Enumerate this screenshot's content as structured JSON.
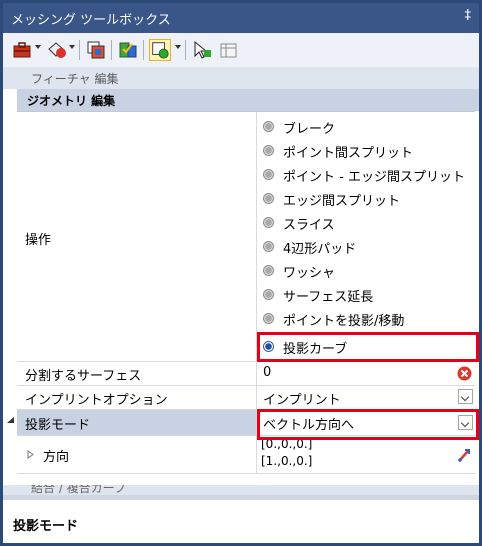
{
  "window": {
    "title": "メッシング ツールボックス",
    "pin_glyph": "‡"
  },
  "subtab": {
    "label": "フィーチャ 編集"
  },
  "category": {
    "label": "ジオメトリ 編集"
  },
  "properties": {
    "operation": {
      "label": "操作",
      "options": [
        "ブレーク",
        "ポイント間スプリット",
        "ポイント - エッジ間スプリット",
        "エッジ間スプリット",
        "スライス",
        "4辺形パッド",
        "ワッシャ",
        "サーフェス延長",
        "ポイントを投影/移動",
        "投影カーブ"
      ],
      "selected": "投影カーブ"
    },
    "split_surface": {
      "label": "分割するサーフェス",
      "value": "0"
    },
    "imprint_option": {
      "label": "インプリントオプション",
      "value": "インプリント"
    },
    "projection_mode": {
      "label": "投影モード",
      "value": "ベクトル方向へ"
    },
    "direction": {
      "label": "方向",
      "value_line1": "[0.,0.,0.]",
      "value_line2": "[1.,0.,0.]"
    }
  },
  "footer": {
    "clipped_next_label": "結合 / 複合カーブ",
    "description_title": "投影モード"
  },
  "colors": {
    "titlebar": "#3a5689",
    "highlight": "#e6001a",
    "category_bg": "#c9d2e2"
  }
}
